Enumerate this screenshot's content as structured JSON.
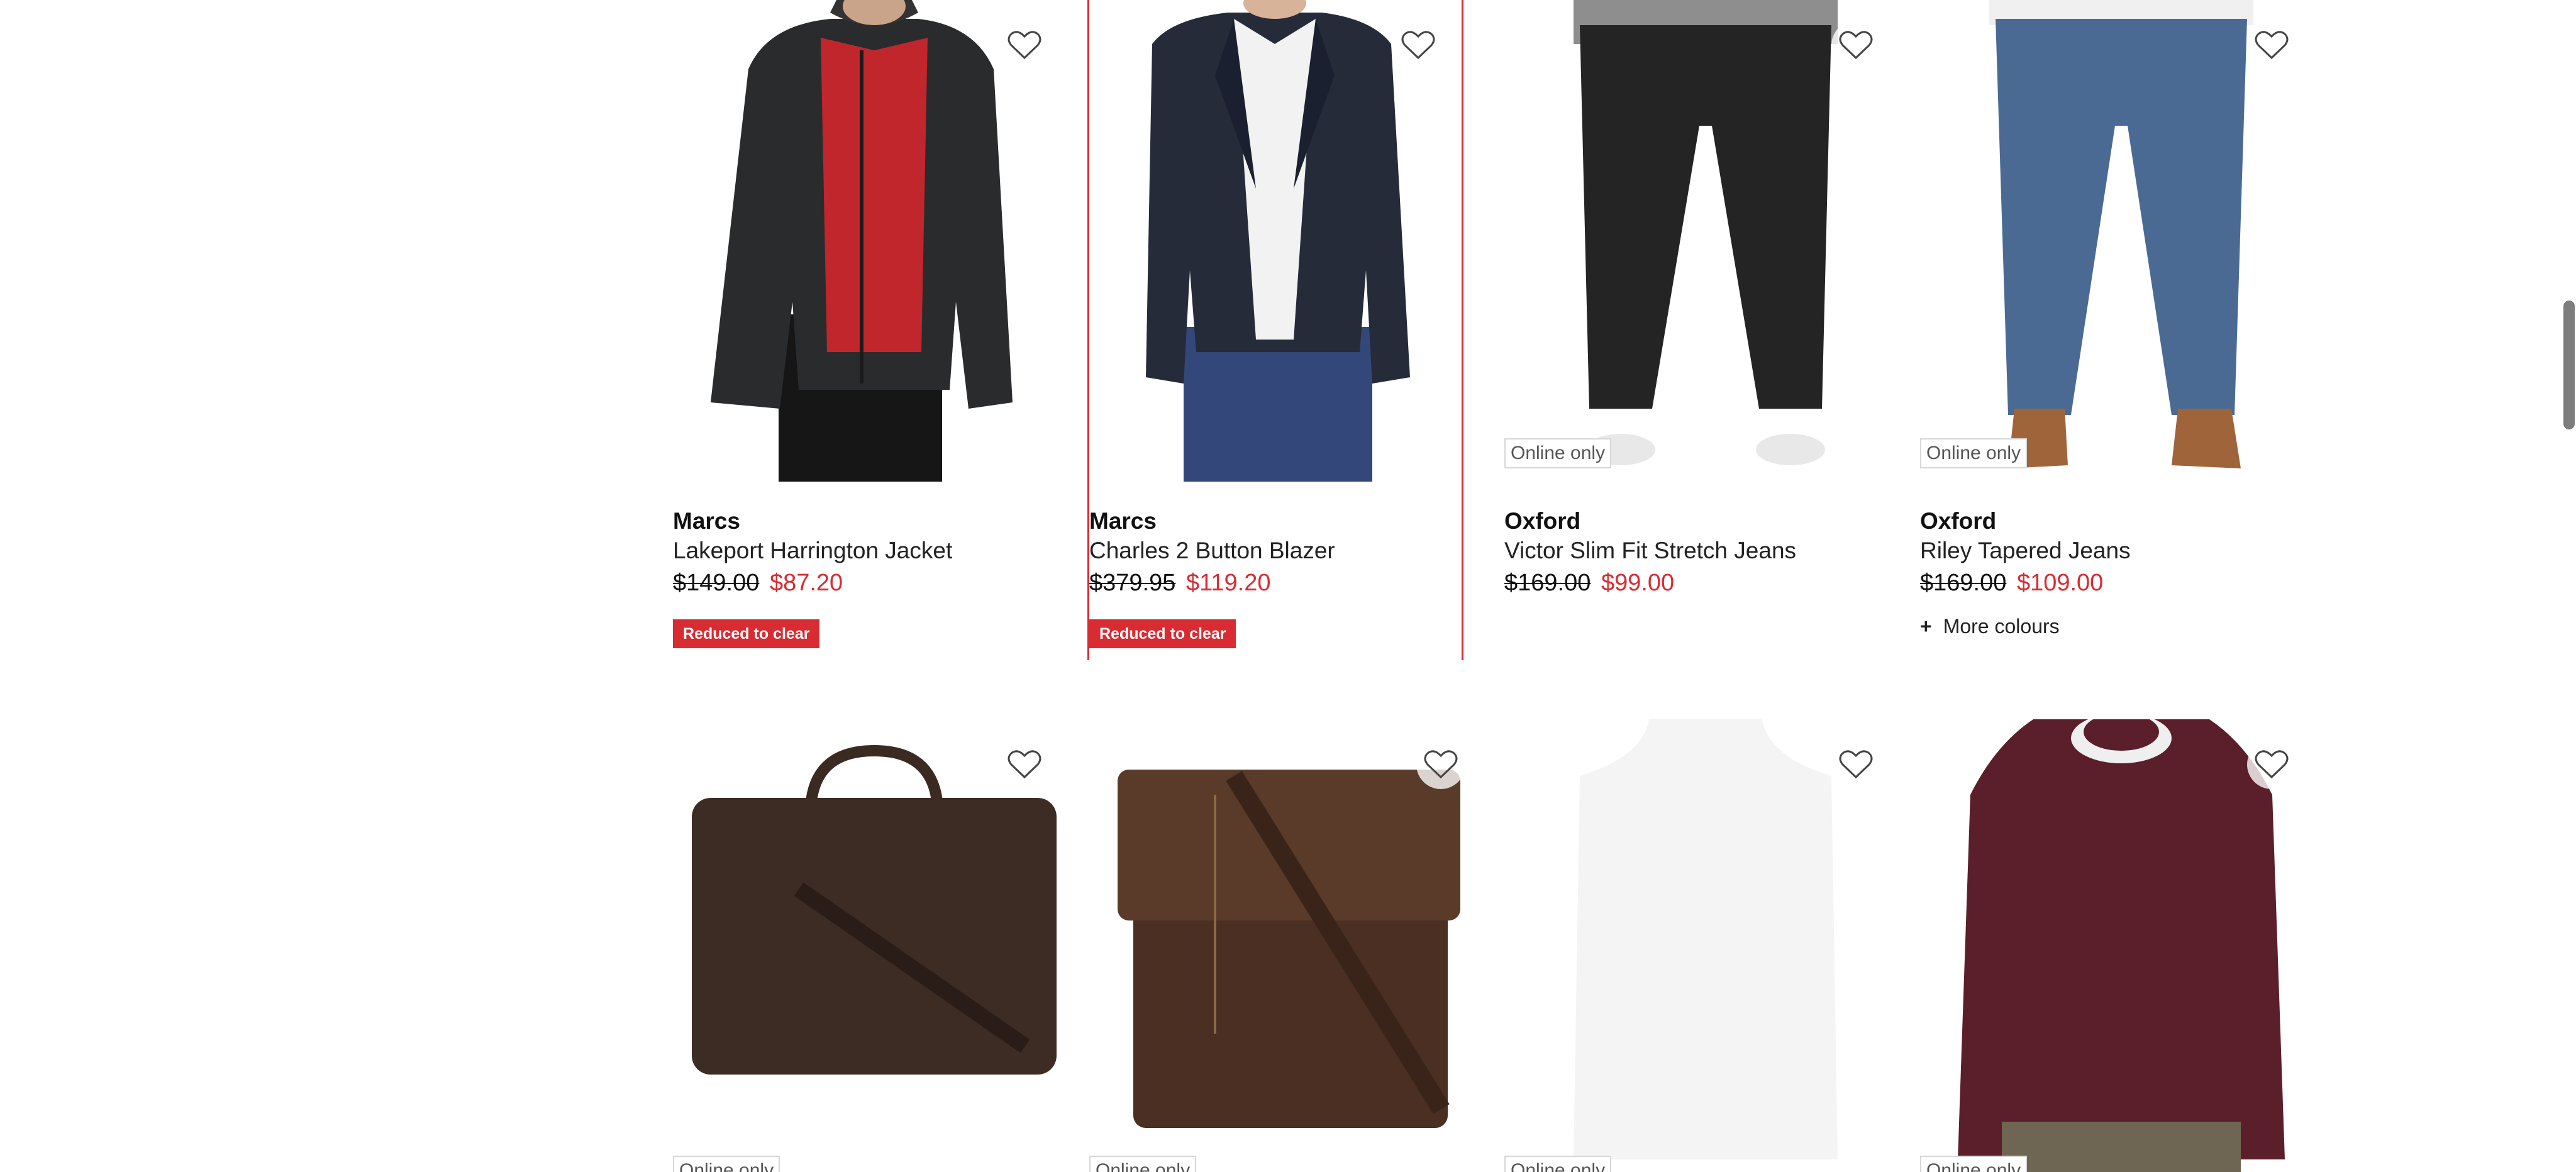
{
  "colors": {
    "sale": "#d92b32",
    "text": "#111111",
    "highlight_border": "#d92b32"
  },
  "products_row1": [
    {
      "brand": "Marcs",
      "name": "Lakeport Harrington Jacket",
      "was": "$149.00",
      "now": "$87.20",
      "tag": "Reduced to clear",
      "icon": "heart-icon"
    },
    {
      "brand": "Marcs",
      "name": "Charles 2 Button Blazer",
      "was": "$379.95",
      "now": "$119.20",
      "tag": "Reduced to clear",
      "icon": "heart-icon"
    },
    {
      "brand": "Oxford",
      "name": "Victor Slim Fit Stretch Jeans",
      "was": "$169.00",
      "now": "$99.00",
      "badge": "Online only",
      "icon": "heart-icon"
    },
    {
      "brand": "Oxford",
      "name": "Riley Tapered Jeans",
      "was": "$169.00",
      "now": "$109.00",
      "badge": "Online only",
      "more": "More colours",
      "icon": "heart-icon"
    }
  ],
  "products_row2": [
    {
      "badge": "Online only",
      "icon": "heart-icon"
    },
    {
      "badge": "Online only",
      "icon": "heart-icon"
    },
    {
      "badge": "Online only",
      "icon": "heart-icon"
    },
    {
      "badge": "Online only",
      "icon": "heart-icon"
    }
  ]
}
